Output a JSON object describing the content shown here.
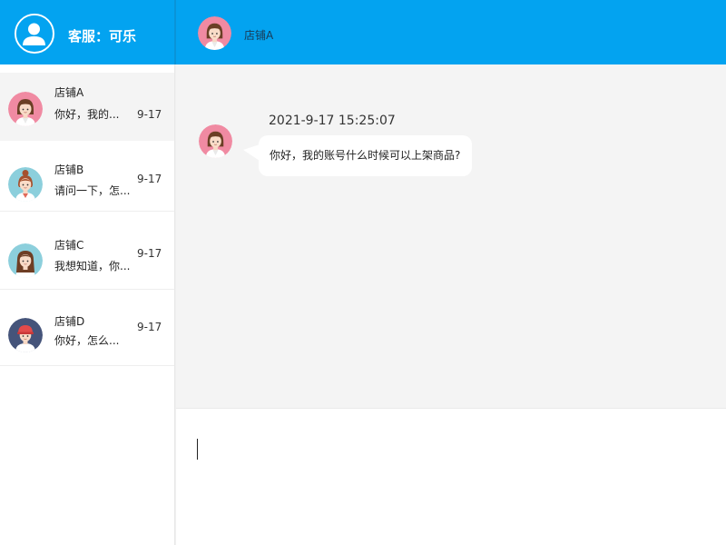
{
  "agent": {
    "label": "客服：可乐",
    "icon": "user-icon"
  },
  "conversations": [
    {
      "name": "店铺A",
      "preview": "你好，我的...",
      "date": "9-17",
      "active": true,
      "avatar": "avatar-girl-pink"
    },
    {
      "name": "店铺B",
      "preview": "请问一下，怎...",
      "date": "9-17",
      "active": false,
      "avatar": "avatar-girl-bun"
    },
    {
      "name": "店铺C",
      "preview": "我想知道，你...",
      "date": "9-17",
      "active": false,
      "avatar": "avatar-girl-long-hair"
    },
    {
      "name": "店铺D",
      "preview": "你好，怎么...",
      "date": "9-17",
      "active": false,
      "avatar": "avatar-boy-cap"
    }
  ],
  "chat": {
    "title": "店铺A",
    "messages": [
      {
        "time": "2021-9-17  15:25:07",
        "text": "你好，我的账号什么时候可以上架商品?"
      }
    ]
  },
  "composer": {
    "value": ""
  },
  "colors": {
    "header_blue": "#03a3f0",
    "active_row": "#f4f4f4",
    "chat_background": "#f4f4f4",
    "avatar_pink": "#f08aa2",
    "avatar_teal": "#8ccfdc",
    "avatar_navy": "#45547a"
  }
}
